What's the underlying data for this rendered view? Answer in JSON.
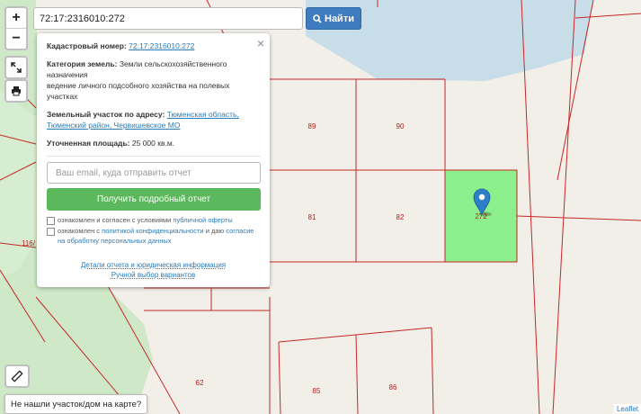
{
  "search": {
    "value": "72:17:2316010:272",
    "button_label": "Найти",
    "icon": "search-icon"
  },
  "zoom": {
    "in_label": "+",
    "out_label": "−"
  },
  "map": {
    "parcels": [
      {
        "label": "89"
      },
      {
        "label": "90"
      },
      {
        "label": "81"
      },
      {
        "label": "82"
      },
      {
        "label": "272"
      },
      {
        "label": "62"
      },
      {
        "label": "85"
      },
      {
        "label": "86"
      },
      {
        "label": "116/"
      }
    ],
    "selected_color": "#8cf08c",
    "line_color": "#c62828"
  },
  "popup": {
    "cadastral_label": "Кадастровый номер:",
    "cadastral_value": "72:17:2316010:272",
    "category_label": "Категория земель:",
    "category_value": "Земли сельскохозяйственного назначения",
    "category_use": "ведение личного подсобного хозяйства на полевых участках",
    "address_label": "Земельный участок по адресу:",
    "address_value": "Тюменская область, Тюменский район, Червишевское МО",
    "area_label": "Уточненная площадь:",
    "area_value": "25 000 кв.м.",
    "email_placeholder": "Ваш email, куда отправить отчет",
    "report_button": "Получить подробный отчет",
    "consent1_text": "ознакомлен и согласен с условиями",
    "consent1_link": "публичной оферты",
    "consent2_text": "ознакомлен с",
    "consent2_link": "политикой конфиденциальности",
    "consent2_mid": "и даю",
    "consent2_link2": "согласие на обработку персональных данных",
    "details_link": "Детали отчета и юридическая информация",
    "manual_link": "Ручной выбор вариантов",
    "close_icon": "×"
  },
  "side_controls": {
    "fullscreen_icon": "expand-icon",
    "print_icon": "printer-icon",
    "ruler_icon": "ruler-icon"
  },
  "bottom_button": "Не нашли участок/дом на карте?",
  "attribution": "Leaflet"
}
